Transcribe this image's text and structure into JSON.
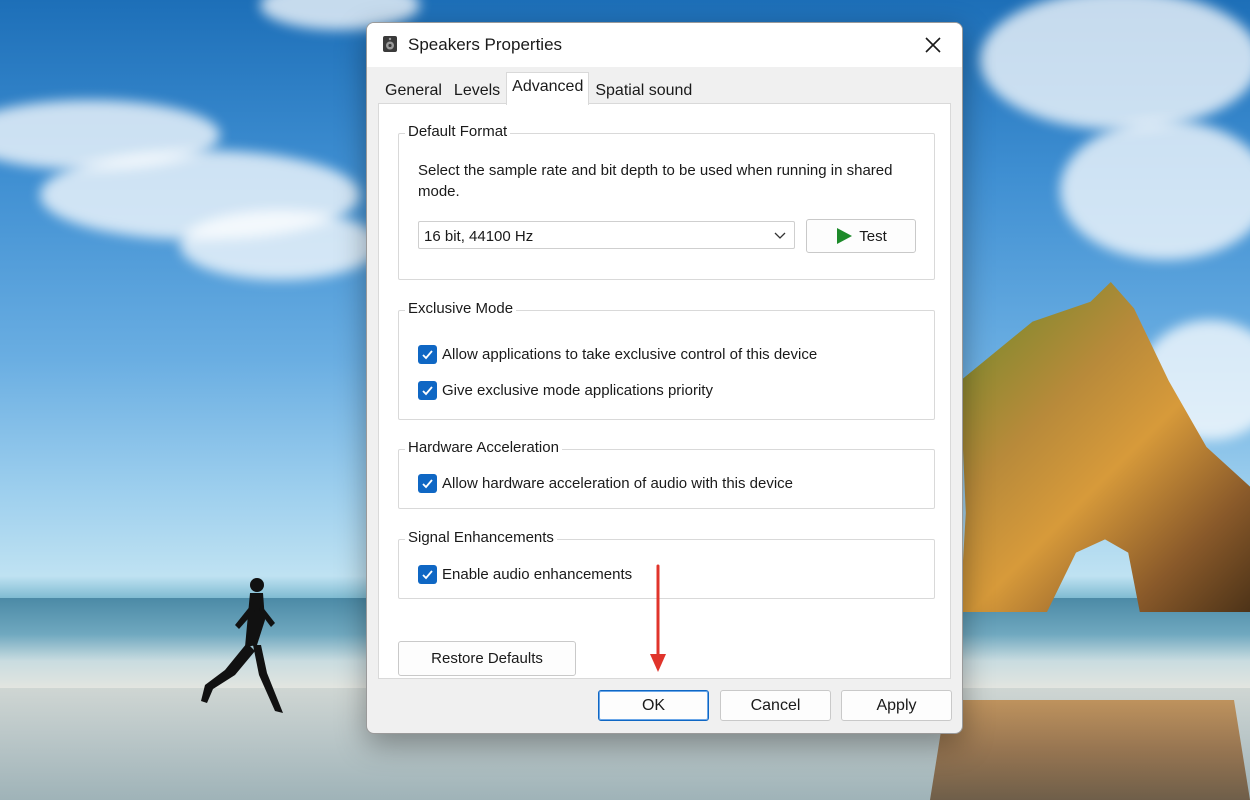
{
  "window": {
    "title": "Speakers Properties",
    "close_icon": "close-icon",
    "speaker_icon": "speaker-icon"
  },
  "tabs": [
    {
      "label": "General",
      "active": false
    },
    {
      "label": "Levels",
      "active": false
    },
    {
      "label": "Advanced",
      "active": true
    },
    {
      "label": "Spatial sound",
      "active": false
    }
  ],
  "default_format": {
    "label": "Default Format",
    "description": "Select the sample rate and bit depth to be used when running in shared mode.",
    "selected_format": "16 bit, 44100 Hz",
    "test_label": "Test",
    "play_icon": "play-icon"
  },
  "exclusive_mode": {
    "label": "Exclusive Mode",
    "options": [
      {
        "label": "Allow applications to take exclusive control of this device",
        "checked": true
      },
      {
        "label": "Give exclusive mode applications priority",
        "checked": true
      }
    ]
  },
  "hardware_acceleration": {
    "label": "Hardware Acceleration",
    "option": {
      "label": "Allow hardware acceleration of audio with this device",
      "checked": true
    }
  },
  "signal_enhancements": {
    "label": "Signal Enhancements",
    "option": {
      "label": "Enable audio enhancements",
      "checked": true
    }
  },
  "restore_defaults_label": "Restore Defaults",
  "footer": {
    "ok_label": "OK",
    "cancel_label": "Cancel",
    "apply_label": "Apply"
  },
  "colors": {
    "accent": "#0f67c4",
    "annotation_arrow": "#e0342b",
    "play_green": "#1d8a2a"
  }
}
